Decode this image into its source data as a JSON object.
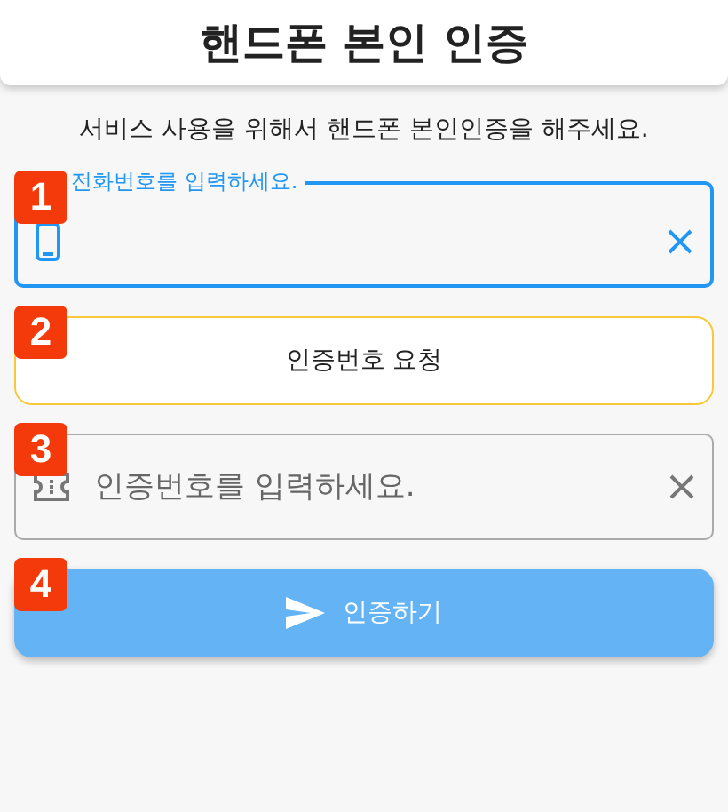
{
  "header": {
    "title": "핸드폰 본인 인증"
  },
  "instruction": "서비스 사용을 위해서 핸드폰 본인인증을 해주세요.",
  "items": [
    {
      "kind": "phone-field",
      "badge": "1",
      "label": "전화번호를 입력하세요.",
      "focused": true
    },
    {
      "kind": "outline-button",
      "badge": "2",
      "label": "인증번호 요청"
    },
    {
      "kind": "code-field",
      "badge": "3",
      "placeholder": "인증번호를 입력하세요.",
      "focused": false
    },
    {
      "kind": "filled-button",
      "badge": "4",
      "label": "인증하기"
    }
  ]
}
